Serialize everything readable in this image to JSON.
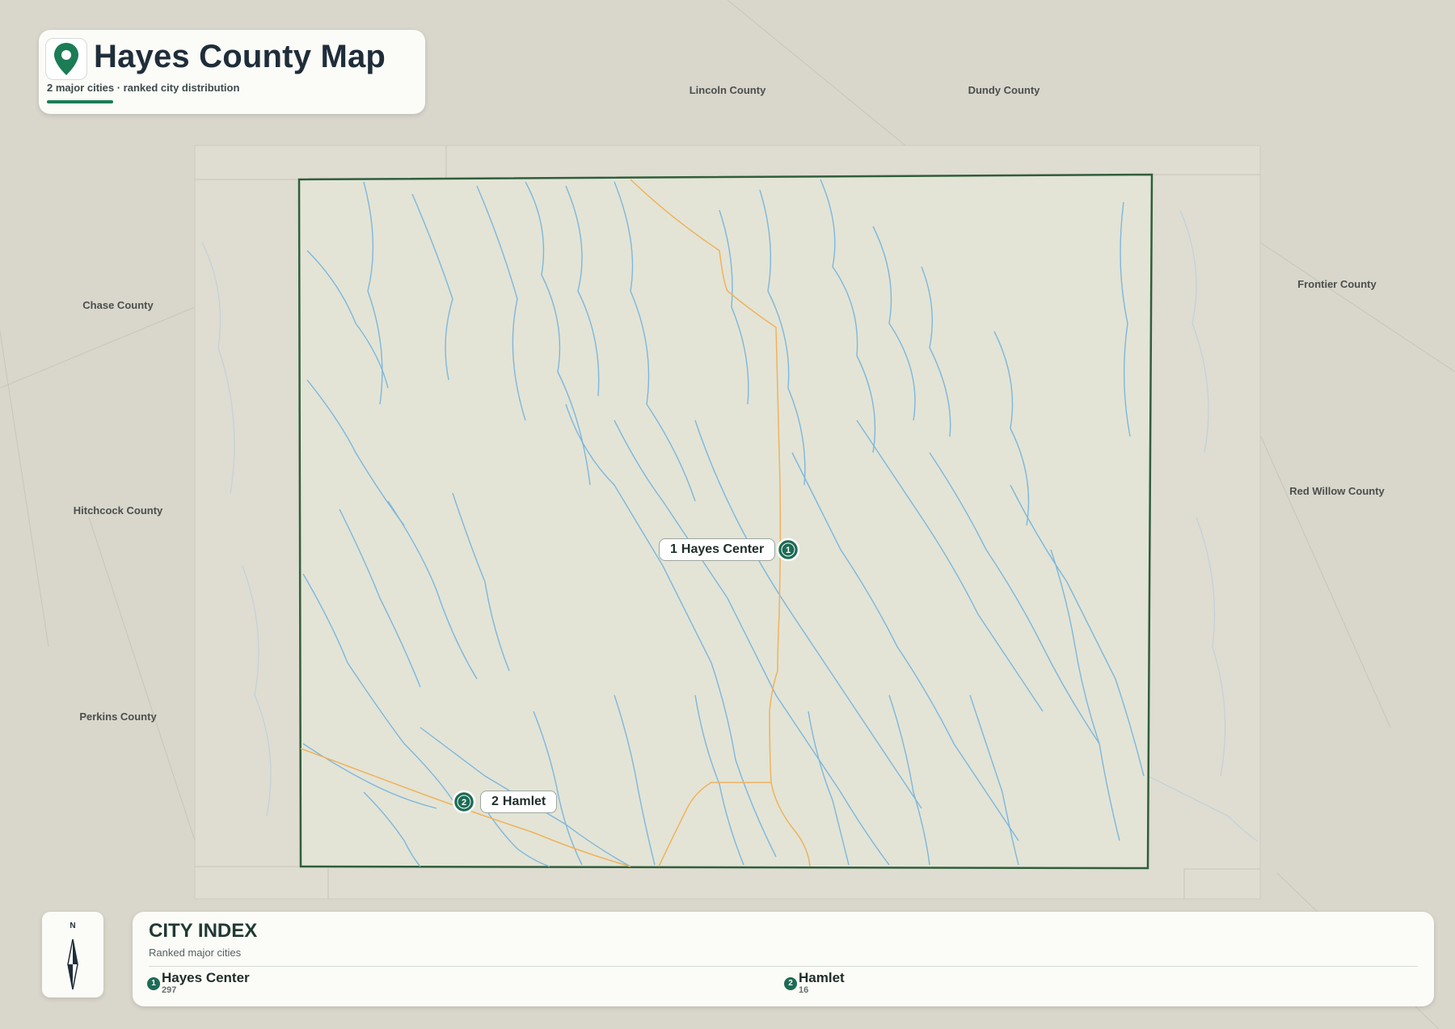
{
  "header": {
    "title": "Hayes County Map",
    "subtitle": "2 major cities · ranked city distribution",
    "icon": "map-pin-icon"
  },
  "colors": {
    "county_fill": "#e3e4d6",
    "county_border": "#2f5e3a",
    "rivers": "#7db7dc",
    "roads": "#f0b25c",
    "accent": "#1b7c56",
    "marker": "#1d6b55"
  },
  "neighbors": [
    {
      "id": "lincoln",
      "name": "Lincoln County"
    },
    {
      "id": "dundy",
      "name": "Dundy County"
    },
    {
      "id": "chase",
      "name": "Chase County"
    },
    {
      "id": "frontier",
      "name": "Frontier County"
    },
    {
      "id": "hitchcock",
      "name": "Hitchcock County"
    },
    {
      "id": "red-willow",
      "name": "Red Willow County"
    },
    {
      "id": "perkins",
      "name": "Perkins County"
    }
  ],
  "cities": [
    {
      "rank": "1",
      "name": "Hayes Center",
      "population": "297"
    },
    {
      "rank": "2",
      "name": "Hamlet",
      "population": "16"
    }
  ],
  "index": {
    "heading": "CITY INDEX",
    "subheading": "Ranked major cities"
  },
  "compass": {
    "north_label": "N",
    "icon": "compass-needle-icon"
  }
}
